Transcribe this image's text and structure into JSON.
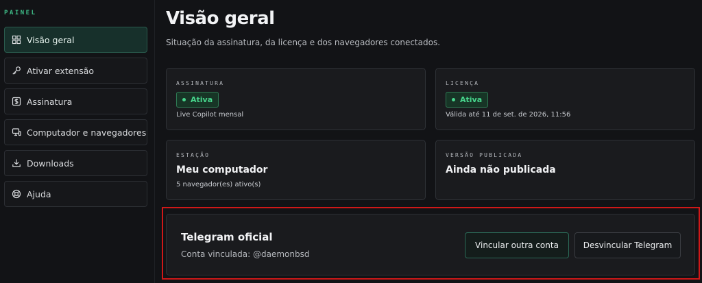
{
  "sidebar": {
    "heading": "PAINEL",
    "items": [
      {
        "label": "Visão geral",
        "icon": "grid-icon",
        "active": true
      },
      {
        "label": "Ativar extensão",
        "icon": "key-icon"
      },
      {
        "label": "Assinatura",
        "icon": "dollar-icon"
      },
      {
        "label": "Computador e navegadores",
        "icon": "monitor-icon"
      },
      {
        "label": "Downloads",
        "icon": "download-icon"
      },
      {
        "label": "Ajuda",
        "icon": "lifebuoy-icon"
      }
    ]
  },
  "main": {
    "title": "Visão geral",
    "subtitle": "Situação da assinatura, da licença e dos navegadores conectados.",
    "cards": {
      "subscription": {
        "label": "ASSINATURA",
        "status": "Ativa",
        "note": "Live Copilot mensal"
      },
      "license": {
        "label": "LICENÇA",
        "status": "Ativa",
        "note": "Válida até 11 de set. de 2026, 11:56"
      },
      "station": {
        "label": "ESTAÇÃO",
        "value": "Meu computador",
        "note": "5 navegador(es) ativo(s)"
      },
      "version": {
        "label": "VERSÃO PUBLICADA",
        "value": "Ainda não publicada"
      }
    },
    "telegram": {
      "title": "Telegram oficial",
      "linked": "Conta vinculada: @daemonbsd",
      "link_other_label": "Vincular outra conta",
      "unlink_label": "Desvincular Telegram"
    }
  },
  "colors": {
    "accent": "#3fbf8a",
    "status_active": "#48d68d",
    "highlight": "#d01818",
    "background": "#121316"
  }
}
